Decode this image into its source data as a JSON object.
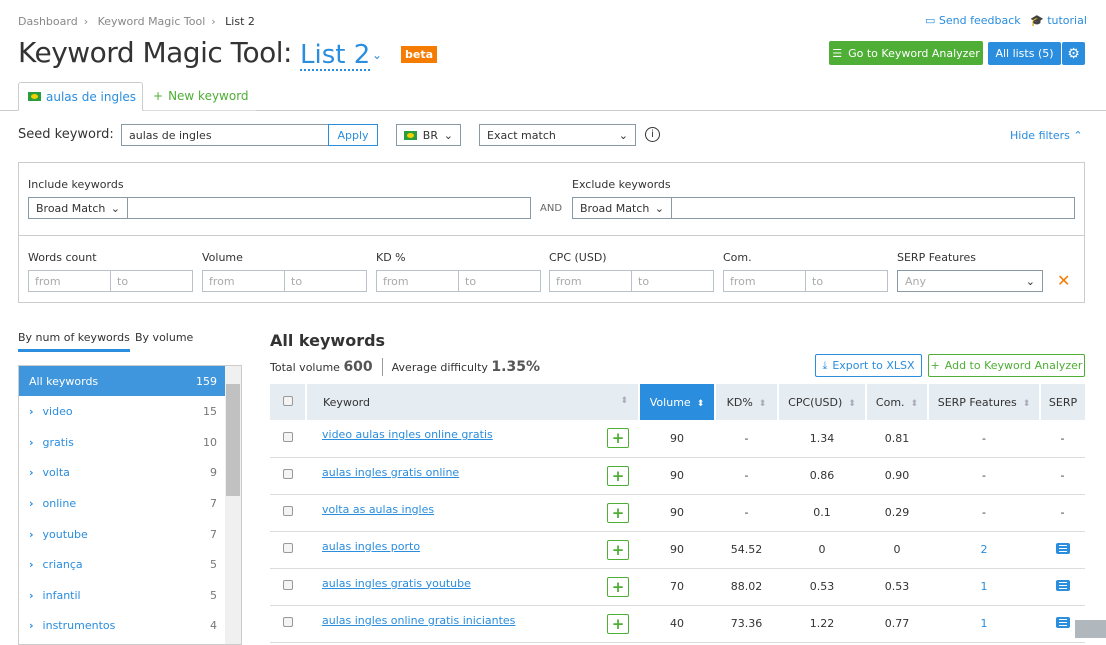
{
  "breadcrumb": [
    "Dashboard",
    "Keyword Magic Tool",
    "List 2"
  ],
  "header": {
    "title": "Keyword Magic Tool:",
    "list_name": "List 2",
    "badge": "beta",
    "send_feedback": "Send feedback",
    "tutorial": "tutorial",
    "go_analyzer": "Go to Keyword Analyzer",
    "all_lists": "All lists (5)"
  },
  "tabs": {
    "active": "aulas de ingles",
    "new": "New keyword"
  },
  "seed": {
    "label": "Seed keyword:",
    "value": "aulas de ingles",
    "apply": "Apply",
    "country": "BR",
    "match": "Exact match",
    "hide_filters": "Hide filters"
  },
  "filters": {
    "include_label": "Include keywords",
    "include_match": "Broad Match",
    "and": "AND",
    "exclude_label": "Exclude keywords",
    "exclude_match": "Broad Match",
    "ranges": [
      {
        "label": "Words count"
      },
      {
        "label": "Volume"
      },
      {
        "label": "KD %"
      },
      {
        "label": "CPC (USD)"
      },
      {
        "label": "Com."
      }
    ],
    "from": "from",
    "to": "to",
    "serp_label": "SERP Features",
    "serp_value": "Any"
  },
  "sidebar": {
    "tab1": "By num of keywords",
    "tab2": "By volume",
    "items": [
      {
        "label": "All keywords",
        "count": "159"
      },
      {
        "label": "video",
        "count": "15"
      },
      {
        "label": "gratis",
        "count": "10"
      },
      {
        "label": "volta",
        "count": "9"
      },
      {
        "label": "online",
        "count": "7"
      },
      {
        "label": "youtube",
        "count": "7"
      },
      {
        "label": "criança",
        "count": "5"
      },
      {
        "label": "infantil",
        "count": "5"
      },
      {
        "label": "instrumentos",
        "count": "4"
      }
    ]
  },
  "main": {
    "title": "All keywords",
    "total_volume_label": "Total volume",
    "total_volume": "600",
    "avg_diff_label": "Average difficulty",
    "avg_diff": "1.35%",
    "export": "Export to XLSX",
    "add_analyzer": "Add to Keyword Analyzer",
    "columns": [
      "Keyword",
      "Volume",
      "KD%",
      "CPC(USD)",
      "Com.",
      "SERP Features",
      "SERP"
    ],
    "rows": [
      {
        "keyword": "video aulas ingles online gratis",
        "volume": "90",
        "kd": "-",
        "cpc": "1.34",
        "com": "0.81",
        "features": "-",
        "serp": "-"
      },
      {
        "keyword": "aulas ingles gratis online",
        "volume": "90",
        "kd": "-",
        "cpc": "0.86",
        "com": "0.90",
        "features": "-",
        "serp": "-"
      },
      {
        "keyword": "volta as aulas ingles",
        "volume": "90",
        "kd": "-",
        "cpc": "0.1",
        "com": "0.29",
        "features": "-",
        "serp": "-"
      },
      {
        "keyword": "aulas ingles porto",
        "volume": "90",
        "kd": "54.52",
        "cpc": "0",
        "com": "0",
        "features": "2",
        "serp": "icon"
      },
      {
        "keyword": "aulas ingles gratis youtube",
        "volume": "70",
        "kd": "88.02",
        "cpc": "0.53",
        "com": "0.53",
        "features": "1",
        "serp": "icon"
      },
      {
        "keyword": "aulas ingles online gratis iniciantes",
        "volume": "40",
        "kd": "73.36",
        "cpc": "1.22",
        "com": "0.77",
        "features": "1",
        "serp": "icon"
      }
    ]
  },
  "colors": {
    "accent": "#2a8ddd",
    "green": "#4eae35",
    "badge": "#f57c00"
  }
}
